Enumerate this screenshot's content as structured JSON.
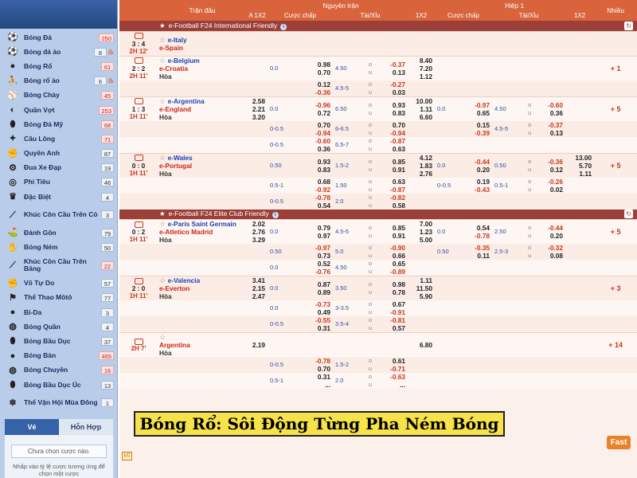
{
  "sidebar": {
    "items": [
      {
        "label": "Bóng Đá",
        "icon": "soccer-ball-icon",
        "count": "250",
        "red": true,
        "fire": false
      },
      {
        "label": "Bóng đá ảo",
        "icon": "soccer-ball-icon",
        "count": "8",
        "red": false,
        "fire": true
      },
      {
        "label": "Bóng Rổ",
        "icon": "basketball-icon",
        "count": "61",
        "red": true,
        "fire": false
      },
      {
        "label": "Bóng rổ ảo",
        "icon": "basketball-player-icon",
        "count": "6",
        "red": false,
        "fire": true
      },
      {
        "label": "Bóng Chày",
        "icon": "baseball-icon",
        "count": "45",
        "red": true,
        "fire": false
      },
      {
        "label": "Quần Vợt",
        "icon": "tennis-icon",
        "count": "253",
        "red": true,
        "fire": false
      },
      {
        "label": "Bóng Đá Mỹ",
        "icon": "american-football-icon",
        "count": "68",
        "red": true,
        "fire": false
      },
      {
        "label": "Cầu Lông",
        "icon": "badminton-icon",
        "count": "71",
        "red": true,
        "fire": false
      },
      {
        "label": "Quyền Anh",
        "icon": "boxing-icon",
        "count": "87",
        "red": false,
        "fire": false
      },
      {
        "label": "Đua Xe Đạp",
        "icon": "cycling-icon",
        "count": "19",
        "red": false,
        "fire": false
      },
      {
        "label": "Phi Tiêu",
        "icon": "darts-icon",
        "count": "46",
        "red": false,
        "fire": false
      },
      {
        "label": "Đặc Biệt",
        "icon": "special-icon",
        "count": "4",
        "red": false,
        "fire": false
      },
      {
        "label": "Khúc Côn Cầu Trên Cỏ",
        "icon": "field-hockey-icon",
        "count": "3",
        "red": false,
        "fire": false,
        "tall": true
      },
      {
        "label": "Đánh Gôn",
        "icon": "golf-icon",
        "count": "79",
        "red": false,
        "fire": false
      },
      {
        "label": "Bóng Ném",
        "icon": "handball-icon",
        "count": "50",
        "red": false,
        "fire": false
      },
      {
        "label": "Khúc Côn Cầu Trên Băng",
        "icon": "ice-hockey-icon",
        "count": "22",
        "red": true,
        "fire": false,
        "tall": true
      },
      {
        "label": "Võ Tự Do",
        "icon": "mma-icon",
        "count": "57",
        "red": false,
        "fire": false
      },
      {
        "label": "Thể Thao Môtô",
        "icon": "motorsport-icon",
        "count": "77",
        "red": false,
        "fire": false
      },
      {
        "label": "Bi-Da",
        "icon": "billiards-icon",
        "count": "3",
        "red": false,
        "fire": false
      },
      {
        "label": "Bóng Quần",
        "icon": "squash-icon",
        "count": "4",
        "red": false,
        "fire": false
      },
      {
        "label": "Bóng Bầu Dục",
        "icon": "rugby-icon",
        "count": "37",
        "red": false,
        "fire": false
      },
      {
        "label": "Bóng Bàn",
        "icon": "table-tennis-icon",
        "count": "465",
        "red": true,
        "fire": false
      },
      {
        "label": "Bóng Chuyền",
        "icon": "volleyball-icon",
        "count": "16",
        "red": true,
        "fire": false
      },
      {
        "label": "Bóng Bầu Dục Úc",
        "icon": "aussie-rules-icon",
        "count": "13",
        "red": false,
        "fire": false
      },
      {
        "label": "Thể Vận Hội Mùa Đông",
        "icon": "winter-olympics-icon",
        "count": "1",
        "red": false,
        "fire": false,
        "tall": true
      }
    ],
    "tab_ve": "Vé",
    "tab_hon_hop": "Hỗn Hợp",
    "slip_placeholder": "Chưa chọn cược nào.",
    "slip_note": "Nhấp vào tỷ lệ cược tương ứng để chọn một cược"
  },
  "header": {
    "col_match": "Trận đấu",
    "col_full": "Nguyên trận",
    "col_half": "Hiệp 1",
    "col_more": "Nhiều",
    "sub_1x2a": "A 1X2",
    "sub_hdp": "Cược chấp",
    "sub_ou": "Tài/Xỉu",
    "sub_1x2": "1X2",
    "sub_hdp2": "Cược chấp",
    "sub_ou2": "Tài/Xỉu",
    "sub_1x2b": "1X2"
  },
  "leagues": [
    {
      "name": "e-Football F24 International Friendly"
    },
    {
      "name": "e-Football F24 Elite Club Friendly"
    }
  ],
  "rows": [
    [
      "3 : 4",
      "2H 12'",
      "e-Italy",
      "e-Spain",
      "",
      "",
      "",
      "",
      "",
      "",
      "",
      "",
      "",
      "",
      "",
      "",
      "",
      "",
      ""
    ],
    [
      "2 : 2",
      "2H 11'",
      "e-Belgium",
      "e-Croatia",
      "Hòa",
      "",
      "0.0",
      "0.98|0.70",
      "4.50",
      "o|u",
      "-0.37|0.13",
      "8.40|7.20|1.12",
      "",
      "",
      "",
      "",
      "",
      "",
      "+ 1"
    ],
    [
      "",
      "",
      "",
      "",
      "",
      "",
      "",
      "0.12|-0.36",
      "4.5-5",
      "o|u",
      "-0.27|0.03",
      "",
      "",
      "",
      "",
      "",
      "",
      "",
      ""
    ],
    [
      "1 : 3",
      "1H 11'",
      "e-Argentina",
      "e-England",
      "Hòa",
      "2.58|2.21|3.20",
      "0.0",
      "-0.96|0.72",
      "6.50",
      "o|u",
      "0.93|0.83",
      "10.00|1.11|6.60",
      "0.0",
      "-0.97|0.65",
      "4.50",
      "o|u",
      "-0.60|0.36",
      "",
      "+ 5"
    ],
    [
      "",
      "",
      "",
      "",
      "",
      "",
      "0-0.5",
      "0.70|-0.94",
      "6-6.5",
      "o|u",
      "0.70|-0.94",
      "",
      "",
      "0.15|-0.39",
      "4.5-5",
      "o|u",
      "-0.37|0.13",
      "",
      ""
    ],
    [
      "",
      "",
      "",
      "",
      "",
      "",
      "0-0.5",
      "-0.60|0.36",
      "6.5-7",
      "o|u",
      "-0.87|0.63",
      "",
      "",
      "",
      "",
      "",
      "",
      "",
      ""
    ],
    [
      "0 : 0",
      "1H 11'",
      "e-Wales",
      "e-Portugal",
      "Hòa",
      "",
      "0.50",
      "0.93|0.83",
      "1.5-2",
      "o|u",
      "0.85|0.91",
      "4.12|1.83|2.76",
      "0.0",
      "-0.44|0.20",
      "0.50",
      "o|u",
      "-0.36|0.12",
      "13.00|5.70|1.11",
      "+ 5"
    ],
    [
      "",
      "",
      "",
      "",
      "",
      "",
      "0.5-1",
      "0.68|-0.92",
      "1.50",
      "o|u",
      "0.63|-0.87",
      "",
      "0-0.5",
      "0.19|-0.43",
      "0.5-1",
      "o|u",
      "-0.26|0.02",
      "",
      ""
    ],
    [
      "",
      "",
      "",
      "",
      "",
      "",
      "0-0.5",
      "-0.78|0.54",
      "2.0",
      "o|u",
      "-0.82|0.58",
      "",
      "",
      "",
      "",
      "",
      "",
      "",
      ""
    ],
    [
      "0 : 2",
      "1H 11'",
      "e-Paris Saint Germain",
      "e-Atletico Madrid",
      "Hòa",
      "2.02|2.76|3.29",
      "0.0",
      "0.79|0.97",
      "4.5-5",
      "o|u",
      "0.85|0.91",
      "7.00|1.23|5.00",
      "0.0",
      "0.54|-0.78",
      "2.50",
      "o|u",
      "-0.44|0.20",
      "",
      "+ 5"
    ],
    [
      "",
      "",
      "",
      "",
      "",
      "",
      "0.50",
      "-0.97|0.73",
      "5.0",
      "o|u",
      "-0.90|0.66",
      "",
      "0.50",
      "-0.35|0.11",
      "2.5-3",
      "o|u",
      "-0.32|0.08",
      "",
      ""
    ],
    [
      "",
      "",
      "",
      "",
      "",
      "",
      "0.0",
      "0.52|-0.76",
      "4.50",
      "o|u",
      "0.65|-0.89",
      "",
      "",
      "",
      "",
      "",
      "",
      "",
      ""
    ],
    [
      "2 : 0",
      "1H 11'",
      "e-Valencia",
      "e-Everton",
      "Hòa",
      "3.41|2.15|2.47",
      "0.0",
      "0.87|0.89",
      "3.50",
      "o|u",
      "0.98|0.78",
      "1.11|11.50|5.90",
      "",
      "",
      "",
      "",
      "",
      "",
      "+ 3"
    ],
    [
      "",
      "",
      "",
      "",
      "",
      "",
      "0.0",
      "-0.73|0.49",
      "3-3.5",
      "o|u",
      "0.67|-0.91",
      "",
      "",
      "",
      "",
      "",
      "",
      "",
      ""
    ],
    [
      "",
      "",
      "",
      "",
      "",
      "",
      "0-0.5",
      "-0.55|0.31",
      "3.5-4",
      "o|u",
      "-0.81|0.57",
      "",
      "",
      "",
      "",
      "",
      "",
      "",
      ""
    ],
    [
      "",
      "2H 7'",
      "",
      "Argentina",
      "Hòa",
      "2.19",
      "",
      "",
      "",
      "",
      "",
      "6.80",
      "",
      "",
      "",
      "",
      "",
      "",
      "+ 14"
    ],
    [
      "",
      "",
      "",
      "",
      "",
      "",
      "0-0.5",
      "-0.78|0.70",
      "1.5-2",
      "o|u",
      "0.61|-0.71",
      "",
      "",
      "",
      "",
      "",
      "",
      "",
      ""
    ],
    [
      "",
      "",
      "",
      "",
      "",
      "",
      "0.5-1",
      "0.31|...",
      "2.0",
      "o|u",
      "-0.63|...",
      "",
      "",
      "",
      "",
      "",
      "",
      "",
      ""
    ]
  ],
  "banner": "Bóng Rổ: Sôi Động Từng Pha Ném Bóng",
  "fast": "Fast",
  "lc": "LC"
}
